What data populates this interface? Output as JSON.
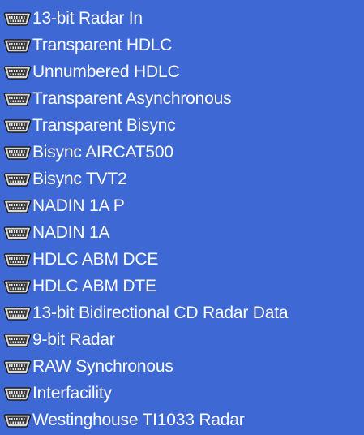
{
  "list": {
    "items": [
      {
        "label": "13-bit Radar In",
        "icon": "connector-icon"
      },
      {
        "label": "Transparent HDLC",
        "icon": "connector-icon"
      },
      {
        "label": "Unnumbered HDLC",
        "icon": "connector-icon"
      },
      {
        "label": "Transparent Asynchronous",
        "icon": "connector-icon"
      },
      {
        "label": "Transparent Bisync",
        "icon": "connector-icon"
      },
      {
        "label": "Bisync AIRCAT500",
        "icon": "connector-icon"
      },
      {
        "label": "Bisync TVT2",
        "icon": "connector-icon"
      },
      {
        "label": "NADIN 1A P",
        "icon": "connector-icon"
      },
      {
        "label": "NADIN 1A",
        "icon": "connector-icon"
      },
      {
        "label": "HDLC ABM DCE",
        "icon": "connector-icon"
      },
      {
        "label": "HDLC ABM DTE",
        "icon": "connector-icon"
      },
      {
        "label": "13-bit Bidirectional CD Radar Data",
        "icon": "connector-icon"
      },
      {
        "label": "9-bit Radar",
        "icon": "connector-icon"
      },
      {
        "label": "RAW Synchronous",
        "icon": "connector-icon"
      },
      {
        "label": "Interfacility",
        "icon": "connector-icon"
      },
      {
        "label": "Westinghouse TI1033 Radar",
        "icon": "connector-icon"
      }
    ]
  },
  "colors": {
    "selection_background": "#3e68d4",
    "text": "#ffffff"
  }
}
